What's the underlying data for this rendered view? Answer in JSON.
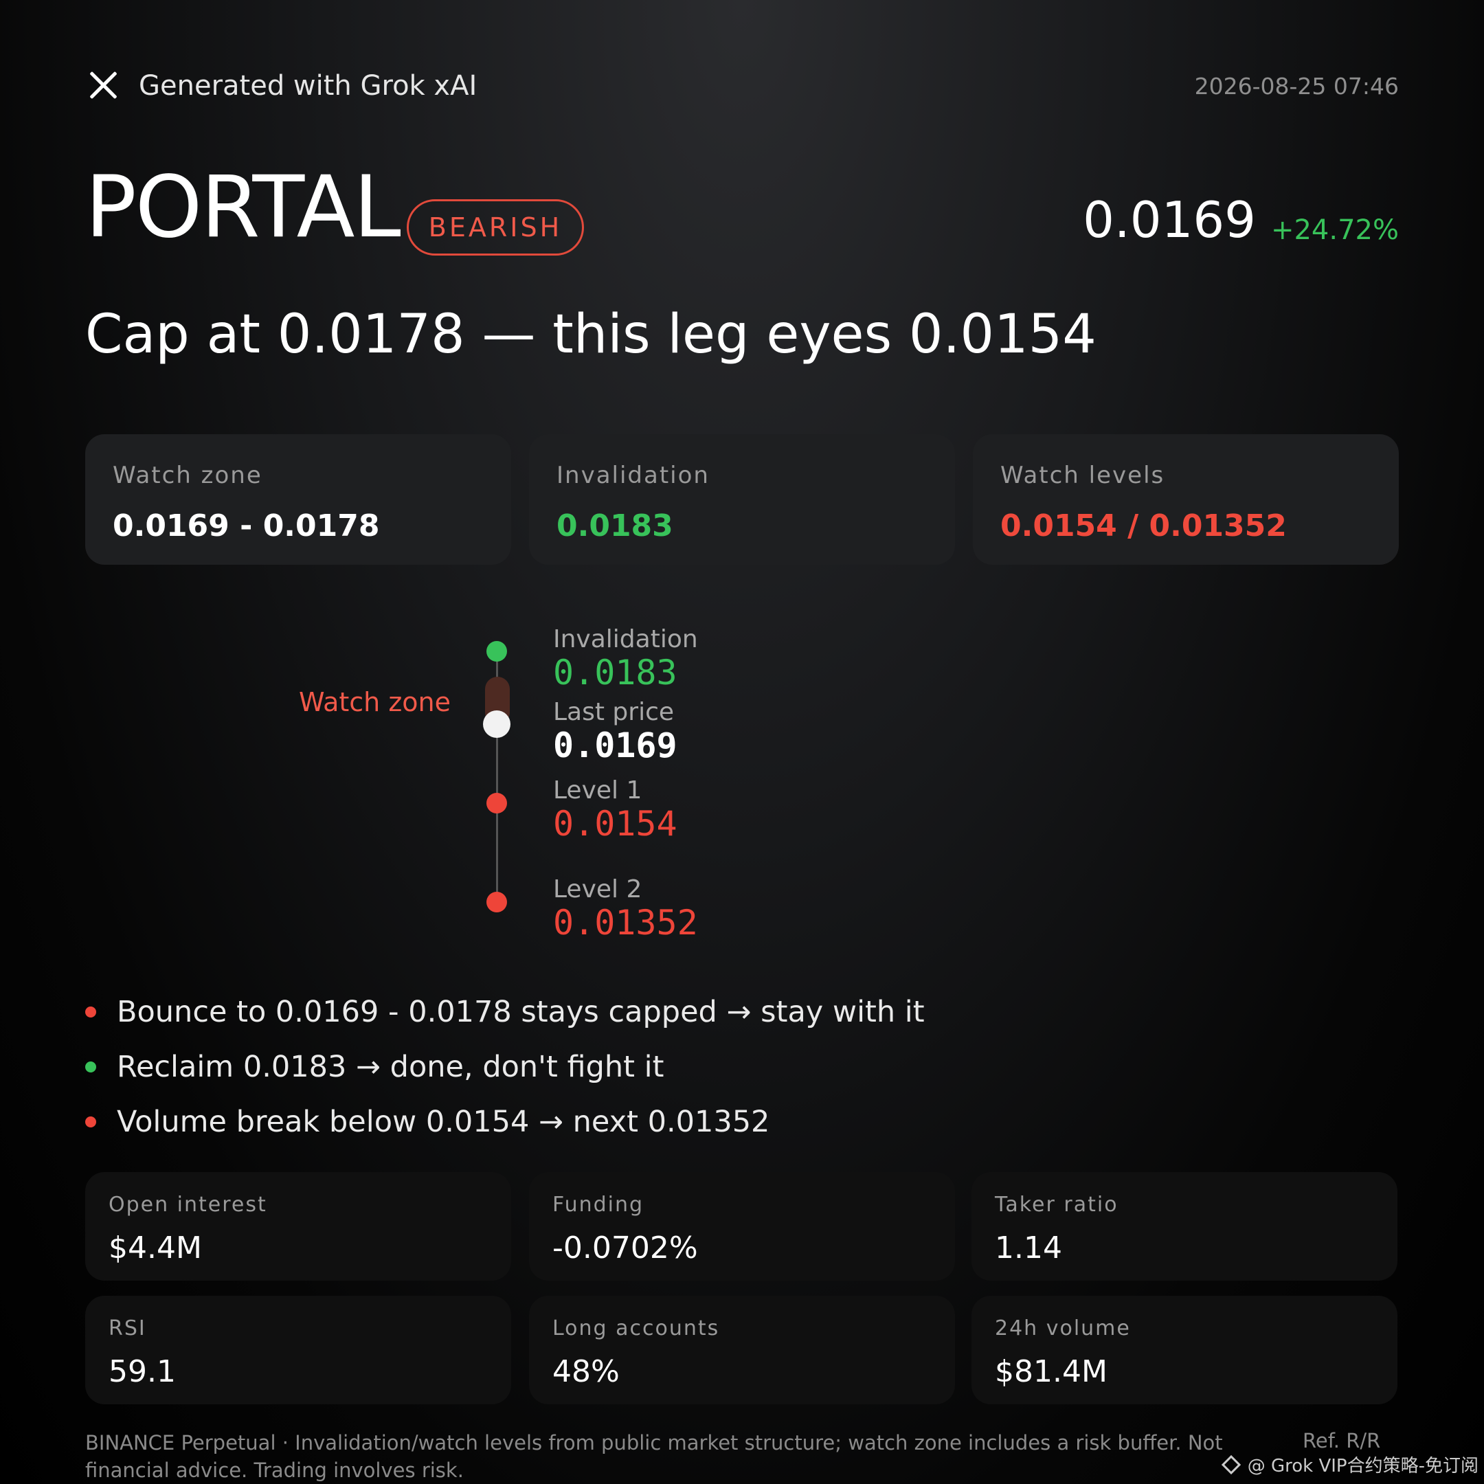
{
  "header": {
    "generated_label": "Generated with Grok xAI",
    "timestamp": "2026-08-25 07:46"
  },
  "asset": {
    "ticker": "PORTAL",
    "bias": "BEARISH",
    "price": "0.0169",
    "change": "+24.72%"
  },
  "headline": "Cap at 0.0178 — this leg eyes 0.0154",
  "summary_cards": [
    {
      "label": "Watch zone",
      "value": "0.0169 - 0.0178",
      "color": "#ffffff"
    },
    {
      "label": "Invalidation",
      "value": "0.0183",
      "color": "#38c25a"
    },
    {
      "label": "Watch levels",
      "value": "0.0154 / 0.01352",
      "color": "#f04a3c"
    }
  ],
  "ladder": {
    "zone_label": "Watch zone",
    "invalidation": {
      "label": "Invalidation",
      "value": "0.0183"
    },
    "last_price": {
      "label": "Last price",
      "value": "0.0169"
    },
    "level1": {
      "label": "Level 1",
      "value": "0.0154"
    },
    "level2": {
      "label": "Level 2",
      "value": "0.01352"
    }
  },
  "bullets": [
    {
      "text": "Bounce to 0.0169 - 0.0178 stays capped → stay with it",
      "color": "#ee4539"
    },
    {
      "text": "Reclaim 0.0183 → done, don't fight it",
      "color": "#38c25a"
    },
    {
      "text": "Volume break below 0.0154 → next 0.01352",
      "color": "#ee4539"
    }
  ],
  "metrics": [
    {
      "label": "Open interest",
      "value": "$4.4M"
    },
    {
      "label": "Funding",
      "value": "-0.0702%"
    },
    {
      "label": "Taker ratio",
      "value": "1.14"
    },
    {
      "label": "RSI",
      "value": "59.1"
    },
    {
      "label": "Long accounts",
      "value": "48%"
    },
    {
      "label": "24h volume",
      "value": "$81.4M"
    }
  ],
  "footer": {
    "disclaimer": "BINANCE Perpetual · Invalidation/watch levels from public market structure; watch zone includes a risk buffer. Not financial advice. Trading involves risk.",
    "ref": "Ref. R/R",
    "watermark": "@ Grok VIP合约策略-免订阅"
  },
  "colors": {
    "bullish": "#38c25a",
    "bearish": "#ee4539",
    "icons": [
      "close-icon",
      "diamond-icon"
    ]
  }
}
